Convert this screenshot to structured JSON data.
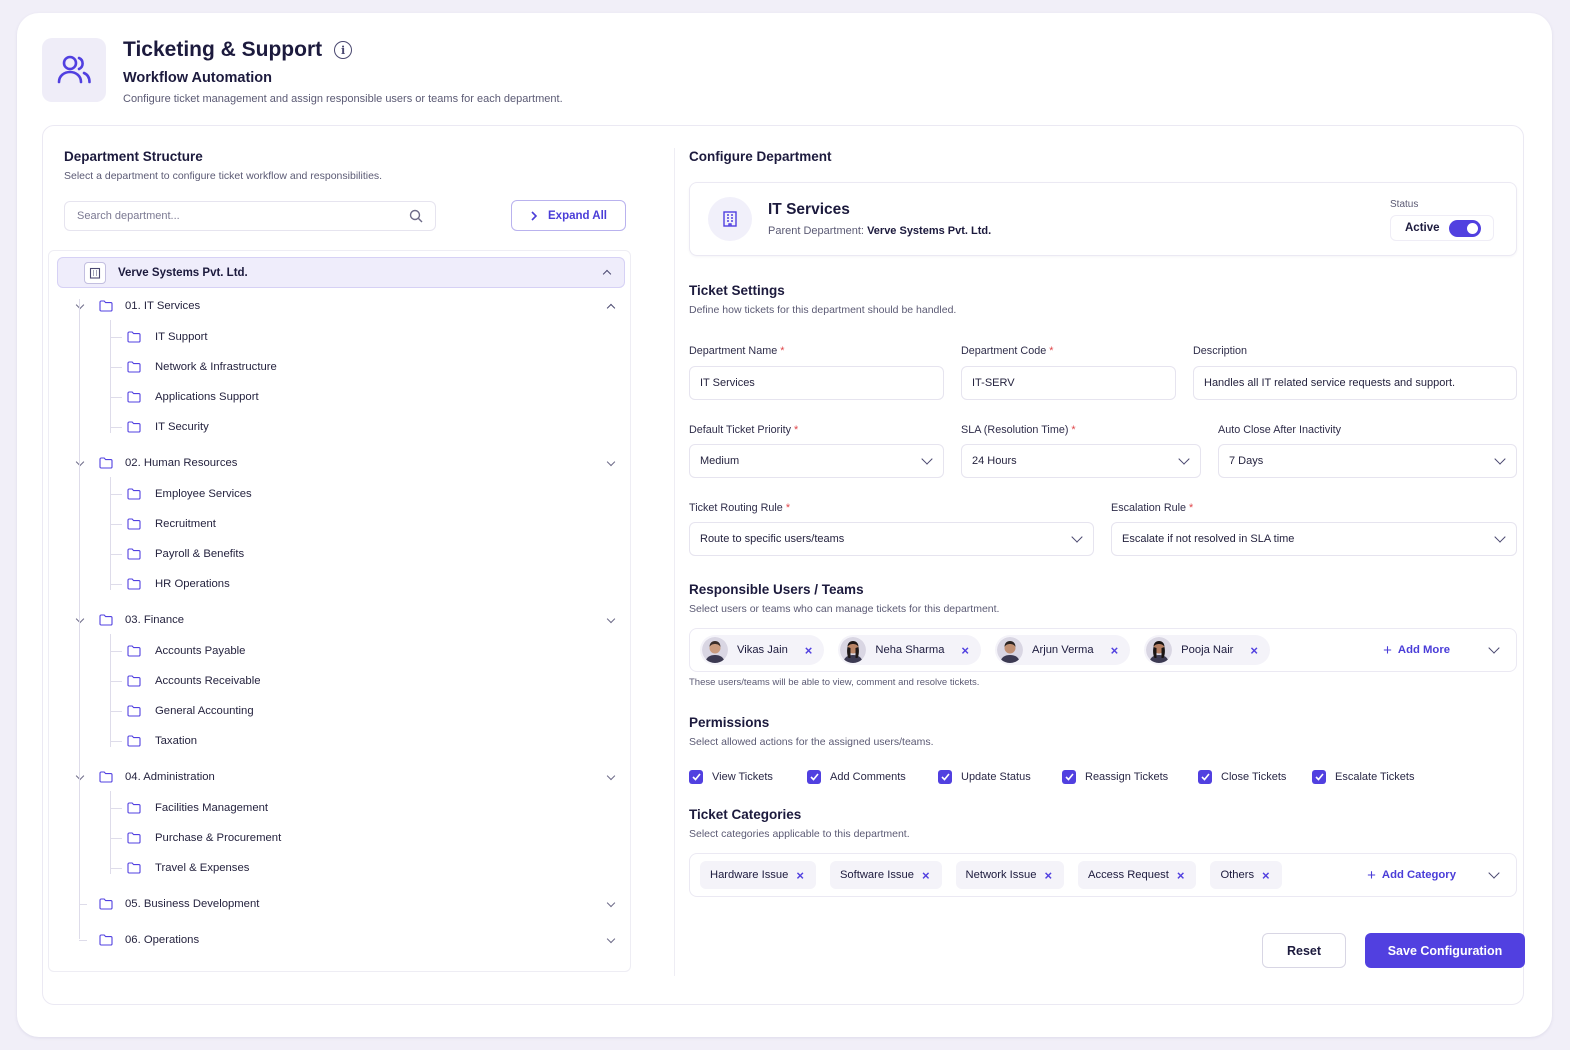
{
  "header": {
    "title": "Ticketing & Support",
    "subtitle": "Workflow Automation",
    "description": "Configure ticket management and assign responsible users or teams for each department."
  },
  "left": {
    "title": "Department Structure",
    "description": "Select a department to configure ticket workflow and responsibilities.",
    "search_placeholder": "Search department...",
    "expand_label": "Expand All",
    "root": "Verve Systems Pvt. Ltd.",
    "departments": [
      {
        "label": "01. IT Services",
        "children": [
          "IT Support",
          "Network & Infrastructure",
          "Applications Support",
          "IT Security"
        ]
      },
      {
        "label": "02. Human Resources",
        "children": [
          "Employee Services",
          "Recruitment",
          "Payroll & Benefits",
          "HR Operations"
        ]
      },
      {
        "label": "03. Finance",
        "children": [
          "Accounts Payable",
          "Accounts Receivable",
          "General Accounting",
          "Taxation"
        ]
      },
      {
        "label": "04. Administration",
        "children": [
          "Facilities Management",
          "Purchase & Procurement",
          "Travel & Expenses"
        ]
      },
      {
        "label": "05. Business Development",
        "children": []
      },
      {
        "label": "06. Operations",
        "children": []
      }
    ]
  },
  "right": {
    "title": "Configure Department",
    "dept_name": "IT Services",
    "parent_label": "Parent Department:",
    "parent_value": "Verve Systems Pvt. Ltd.",
    "status_label": "Status",
    "status_value": "Active",
    "ticket_settings": {
      "title": "Ticket Settings",
      "description": "Define how tickets for this department should be handled.",
      "dept_name_label": "Department Name",
      "dept_name_value": "IT Services",
      "dept_code_label": "Department Code",
      "dept_code_value": "IT-SERV",
      "description_label": "Description",
      "description_value": "Handles all IT related service requests and support.",
      "priority_label": "Default Ticket Priority",
      "priority_value": "Medium",
      "sla_label": "SLA (Resolution Time)",
      "sla_value": "24 Hours",
      "autoclose_label": "Auto Close After Inactivity",
      "autoclose_value": "7 Days",
      "routing_label": "Ticket Routing Rule",
      "routing_value": "Route to specific users/teams",
      "escalation_label": "Escalation Rule",
      "escalation_value": "Escalate if not resolved in SLA time"
    },
    "responsible": {
      "title": "Responsible Users / Teams",
      "description": "Select users or teams who can manage tickets for this department.",
      "users": [
        "Vikas Jain",
        "Neha Sharma",
        "Arjun Verma",
        "Pooja Nair"
      ],
      "add_label": "Add More",
      "note": "These users/teams will be able to view, comment and resolve tickets."
    },
    "permissions": {
      "title": "Permissions",
      "description": "Select allowed actions for the assigned users/teams.",
      "items": [
        "View Tickets",
        "Add Comments",
        "Update Status",
        "Reassign Tickets",
        "Close Tickets",
        "Escalate Tickets"
      ]
    },
    "categories": {
      "title": "Ticket Categories",
      "description": "Select categories applicable to this department.",
      "items": [
        "Hardware Issue",
        "Software Issue",
        "Network Issue",
        "Access Request",
        "Others"
      ],
      "add_label": "Add Category"
    },
    "reset_label": "Reset",
    "save_label": "Save Configuration"
  },
  "colors": {
    "accent": "#5140e0",
    "required": "#e0464a",
    "selected_bg": "#efedfb"
  }
}
